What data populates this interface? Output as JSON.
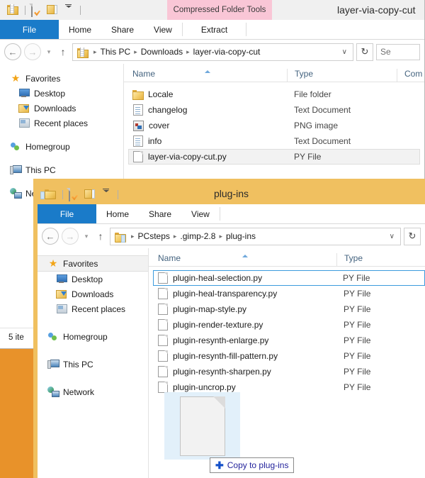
{
  "desktop": {
    "background_color": "#e8922a"
  },
  "window1": {
    "title": "layer-via-copy-cut",
    "contextual_tab_group": "Compressed Folder Tools",
    "contextual_tab_color": "#f9c6d6",
    "quick_access": [
      {
        "icon": "zip-folder-icon"
      },
      {
        "icon": "properties-icon"
      },
      {
        "icon": "new-folder-icon"
      },
      {
        "icon": "customize-dropdown-icon"
      }
    ],
    "tabs": [
      {
        "label": "File",
        "active": true
      },
      {
        "label": "Home",
        "active": false
      },
      {
        "label": "Share",
        "active": false
      },
      {
        "label": "View",
        "active": false
      },
      {
        "label": "Extract",
        "active": false
      }
    ],
    "address": {
      "back_label": "←",
      "forward_label": "→",
      "recent_label": "▾",
      "up_label": "↑",
      "icon": "zip-folder-icon",
      "crumbs": [
        "This PC",
        "Downloads",
        "layer-via-copy-cut"
      ],
      "dropdown_label": "∨",
      "refresh_label": "↻",
      "search_text": "Se"
    },
    "nav": {
      "items": [
        {
          "label": "Favorites",
          "icon": "star-icon",
          "level": 0,
          "selected": false
        },
        {
          "label": "Desktop",
          "icon": "desktop-icon",
          "level": 1,
          "selected": false
        },
        {
          "label": "Downloads",
          "icon": "downloads-folder-icon",
          "level": 1,
          "selected": false
        },
        {
          "label": "Recent places",
          "icon": "recent-places-icon",
          "level": 1,
          "selected": false
        },
        {
          "label": "Homegroup",
          "icon": "homegroup-icon",
          "level": 0,
          "selected": false
        },
        {
          "label": "This PC",
          "icon": "this-pc-icon",
          "level": 0,
          "selected": false
        },
        {
          "label": "Network",
          "icon": "network-icon",
          "level": 0,
          "selected": false
        }
      ]
    },
    "columns": [
      "Name",
      "Type",
      "Com"
    ],
    "sort_column": "Name",
    "files": [
      {
        "name": "Locale",
        "type": "File folder",
        "icon": "folder-icon",
        "selected": false
      },
      {
        "name": "changelog",
        "type": "Text Document",
        "icon": "text-file-icon",
        "selected": false
      },
      {
        "name": "cover",
        "type": "PNG image",
        "icon": "png-image-icon",
        "selected": false
      },
      {
        "name": "info",
        "type": "Text Document",
        "icon": "text-file-icon",
        "selected": false
      },
      {
        "name": "layer-via-copy-cut.py",
        "type": "PY File",
        "icon": "py-file-icon",
        "selected": true
      }
    ],
    "status": "5 ite"
  },
  "window2": {
    "title": "plug-ins",
    "titlebar_color": "#f0c060",
    "quick_access": [
      {
        "icon": "folder-icon"
      },
      {
        "icon": "properties-icon"
      },
      {
        "icon": "new-folder-icon"
      },
      {
        "icon": "customize-dropdown-icon"
      }
    ],
    "tabs": [
      {
        "label": "File",
        "active": true
      },
      {
        "label": "Home",
        "active": false
      },
      {
        "label": "Share",
        "active": false
      },
      {
        "label": "View",
        "active": false
      }
    ],
    "address": {
      "back_label": "←",
      "forward_label": "→",
      "recent_label": "▾",
      "up_label": "↑",
      "icon": "folder-icon",
      "crumbs": [
        "PCsteps",
        ".gimp-2.8",
        "plug-ins"
      ],
      "dropdown_label": "∨",
      "refresh_label": "↻"
    },
    "nav": {
      "items": [
        {
          "label": "Favorites",
          "icon": "star-icon",
          "level": 0,
          "selected": true
        },
        {
          "label": "Desktop",
          "icon": "desktop-icon",
          "level": 1,
          "selected": false
        },
        {
          "label": "Downloads",
          "icon": "downloads-folder-icon",
          "level": 1,
          "selected": false
        },
        {
          "label": "Recent places",
          "icon": "recent-places-icon",
          "level": 1,
          "selected": false
        },
        {
          "label": "Homegroup",
          "icon": "homegroup-icon",
          "level": 0,
          "selected": false
        },
        {
          "label": "This PC",
          "icon": "this-pc-icon",
          "level": 0,
          "selected": false
        },
        {
          "label": "Network",
          "icon": "network-icon",
          "level": 0,
          "selected": false
        }
      ]
    },
    "columns": [
      "Name",
      "Type"
    ],
    "sort_column": "Name",
    "files": [
      {
        "name": "plugin-heal-selection.py",
        "type": "PY File",
        "icon": "py-file-icon",
        "focused": true
      },
      {
        "name": "plugin-heal-transparency.py",
        "type": "PY File",
        "icon": "py-file-icon",
        "focused": false
      },
      {
        "name": "plugin-map-style.py",
        "type": "PY File",
        "icon": "py-file-icon",
        "focused": false
      },
      {
        "name": "plugin-render-texture.py",
        "type": "PY File",
        "icon": "py-file-icon",
        "focused": false
      },
      {
        "name": "plugin-resynth-enlarge.py",
        "type": "PY File",
        "icon": "py-file-icon",
        "focused": false
      },
      {
        "name": "plugin-resynth-fill-pattern.py",
        "type": "PY File",
        "icon": "py-file-icon",
        "focused": false
      },
      {
        "name": "plugin-resynth-sharpen.py",
        "type": "PY File",
        "icon": "py-file-icon",
        "focused": false
      },
      {
        "name": "plugin-uncrop.py",
        "type": "PY File",
        "icon": "py-file-icon",
        "focused": false
      }
    ]
  },
  "drag": {
    "tooltip": "Copy to plug-ins",
    "plus_glyph": "✚",
    "ghost_icon": "py-file-icon"
  }
}
